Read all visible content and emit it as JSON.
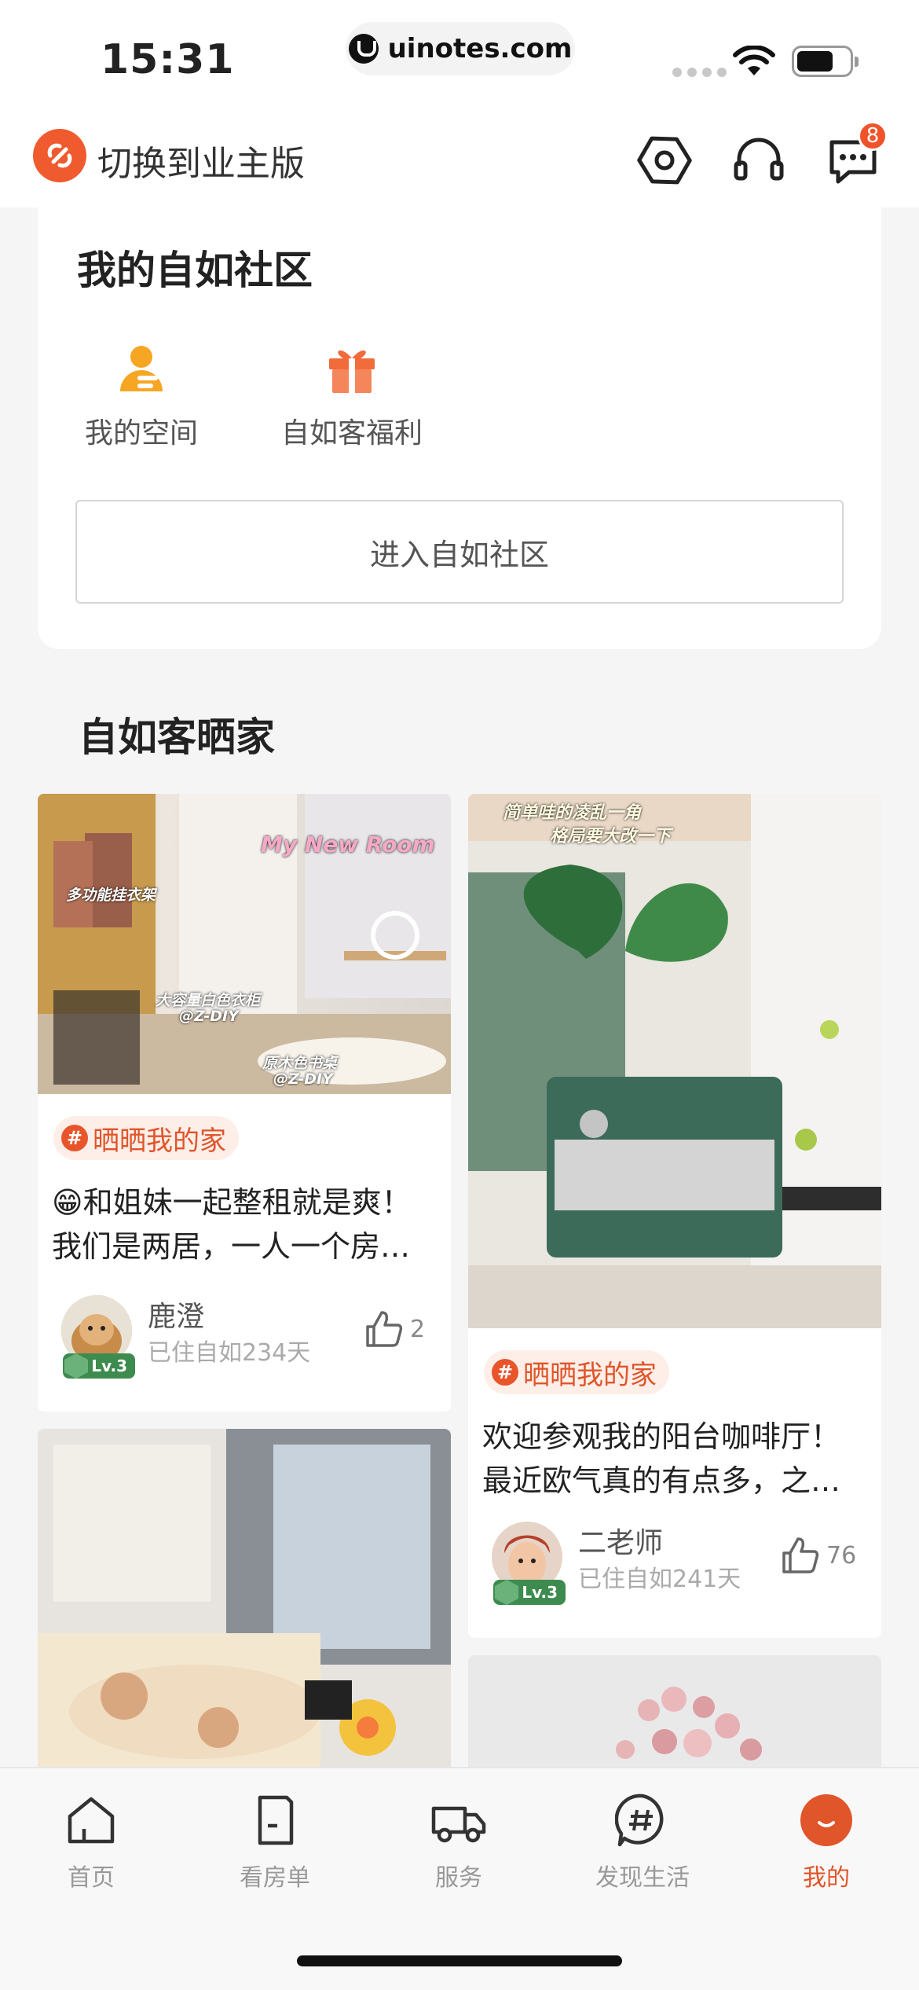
{
  "status_bar": {
    "time": "15:31",
    "url": "uinotes.com"
  },
  "header": {
    "switch_label": "切换到业主版",
    "icons": [
      "settings-hexagon-icon",
      "headset-icon",
      "message-icon"
    ],
    "message_badge": "8",
    "brand_color": "#ef5b2e"
  },
  "community": {
    "title": "我的自如社区",
    "shortcuts": [
      {
        "label": "我的空间",
        "icon": "user-space-icon"
      },
      {
        "label": "自如客福利",
        "icon": "gift-icon"
      }
    ],
    "enter_button": "进入自如社区"
  },
  "feed": {
    "title": "自如客晒家",
    "cards": [
      {
        "photo_texts": [
          "My New Room",
          "多功能挂衣架",
          "大容量白色衣柜",
          "@Z-DIY",
          "原木色书桌",
          "@Z-DIY"
        ],
        "tag": "晒晒我的家",
        "desc_line1": "😁和姐妹一起整租就是爽！",
        "desc_line2": "我们是两居，一人一个房间，还有一个...",
        "user": "鹿澄",
        "level": "Lv.3",
        "days": "已住自如234天",
        "likes": "2"
      },
      {
        "photo_texts": [
          "简单哇的凌乱一角",
          "格局要大改一下"
        ],
        "tag": "晒晒我的家",
        "desc_line1": "欢迎参观我的阳台咖啡厅！",
        "desc_line2": "最近欧气真的有点多，之前一直想要...",
        "user": "二老师",
        "level": "Lv.3",
        "days": "已住自如241天",
        "likes": "76"
      }
    ]
  },
  "tabbar": {
    "tabs": [
      {
        "label": "首页",
        "icon": "home-icon"
      },
      {
        "label": "看房单",
        "icon": "list-icon"
      },
      {
        "label": "服务",
        "icon": "truck-icon"
      },
      {
        "label": "发现生活",
        "icon": "hashtag-icon"
      },
      {
        "label": "我的",
        "icon": "profile-icon",
        "active": true
      }
    ],
    "active_color": "#e0552a"
  }
}
